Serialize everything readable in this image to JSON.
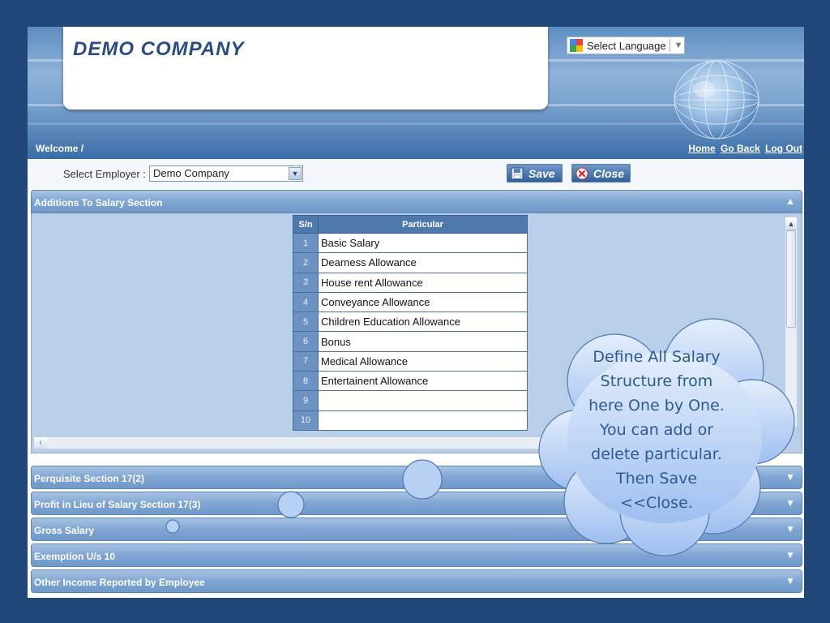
{
  "header": {
    "company_name": "DEMO COMPANY",
    "language_selector": "Select Language",
    "welcome": "Welcome /",
    "links": {
      "home": "Home",
      "go_back": "Go Back",
      "log_out": "Log Out"
    }
  },
  "employer_bar": {
    "label": "Select Employer :",
    "selected": "Demo Company",
    "save_label": "Save",
    "close_label": "Close"
  },
  "sections": {
    "additions": "Additions To Salary Section",
    "perquisite": "Perquisite Section 17(2)",
    "profit": "Profit in Lieu of Salary Section 17(3)",
    "gross": "Gross Salary",
    "exemption": "Exemption U/s 10",
    "other_income": "Other Income Reported by Employee"
  },
  "salary_table": {
    "headers": {
      "sn": "S/n",
      "particular": "Particular"
    },
    "rows": [
      {
        "sn": "1",
        "particular": "Basic Salary"
      },
      {
        "sn": "2",
        "particular": "Dearness Allowance"
      },
      {
        "sn": "3",
        "particular": "House rent Allowance"
      },
      {
        "sn": "4",
        "particular": "Conveyance Allowance"
      },
      {
        "sn": "5",
        "particular": "Children Education Allowance"
      },
      {
        "sn": "6",
        "particular": "Bonus"
      },
      {
        "sn": "7",
        "particular": "Medical Allowance"
      },
      {
        "sn": "8",
        "particular": "Entertainent Allowance"
      },
      {
        "sn": "9",
        "particular": ""
      },
      {
        "sn": "10",
        "particular": ""
      }
    ]
  },
  "callout": {
    "lines": [
      "Define All Salary",
      "Structure from",
      "here One by One.",
      "You can add or",
      "delete particular.",
      "Then Save",
      "<<Close."
    ]
  },
  "colors": {
    "page_background": "#1f4779",
    "section_header": "#7fa5d2",
    "cloud_fill": "#b8d0f7",
    "callout_text": "#2c5a92"
  },
  "icons": {
    "save": "floppy-disk-icon",
    "close": "red-x-icon",
    "collapse": "chevron-up-icon",
    "expand": "chevron-down-icon",
    "language": "google-translate-icon"
  }
}
